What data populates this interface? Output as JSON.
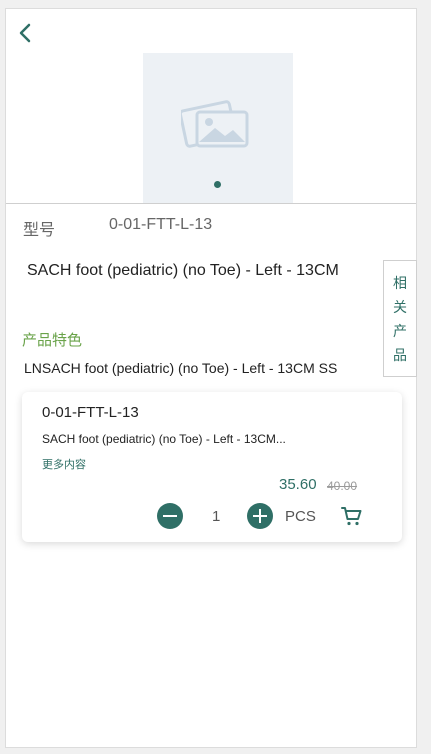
{
  "product": {
    "model_label": "型号",
    "model_value": "0-01-FTT-L-13",
    "title": "SACH foot (pediatric) (no Toe) - Left - 13CM",
    "related_label_chars": [
      "相",
      "关",
      "产",
      "品"
    ],
    "feature_label": "产品特色",
    "feature_text": "LNSACH foot (pediatric) (no Toe) - Left - 13CM SS"
  },
  "card": {
    "code": "0-01-FTT-L-13",
    "name": "SACH foot (pediatric) (no Toe) - Left - 13CM...",
    "more_label": "更多内容",
    "price": "35.60",
    "old_price": "40.00",
    "quantity": "1",
    "unit": "PCS"
  },
  "icons": {
    "back": "chevron-left-icon",
    "image_placeholder": "image-icon",
    "minus": "minus-circle-icon",
    "plus": "plus-circle-icon",
    "cart": "cart-icon"
  },
  "colors": {
    "accent": "#2f6f66",
    "feature_green": "#6aa34a",
    "placeholder_bg": "#edf1f5"
  }
}
